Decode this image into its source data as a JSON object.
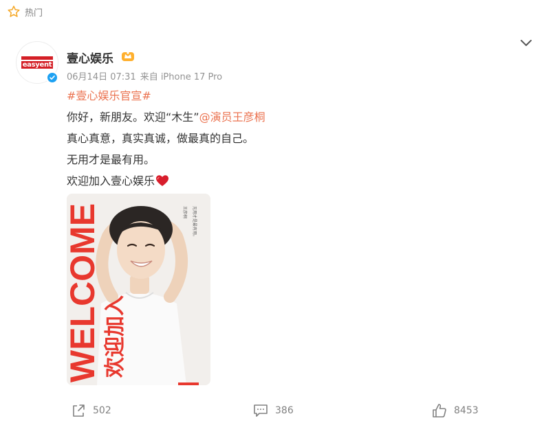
{
  "feed_tag": {
    "label": "热门",
    "icon": "star-outline-icon",
    "color": "#f5a623"
  },
  "user": {
    "name": "壹心娱乐",
    "avatar_logo_text": "easyent",
    "verified": true,
    "badge_icon": "vip-crown-icon"
  },
  "post": {
    "date": "06月14日 07:31",
    "source": "来自 iPhone 17 Pro",
    "hashtag": "#壹心娱乐官宣#",
    "line1_text": "你好，新朋友。欢迎“木生”",
    "line1_mention": "@演员王彦桐",
    "line2": "真心真意，真实真诚，做最真的自己。",
    "line3": "无用才是最有用。",
    "line4": "欢迎加入壹心娱乐",
    "line4_emoji": "heart-icon"
  },
  "image": {
    "banner_text": "WELCOME",
    "subtitle_text": "欢迎加入",
    "caption_name": "王彦桐",
    "caption_quote": "无用才是最有用。"
  },
  "actions": {
    "repost_count": "502",
    "comment_count": "386",
    "like_count": "8453"
  },
  "colors": {
    "link": "#eb7350",
    "brand_red": "#d41f26",
    "verified_blue": "#1da1f2",
    "banner_red": "#e8382e"
  }
}
